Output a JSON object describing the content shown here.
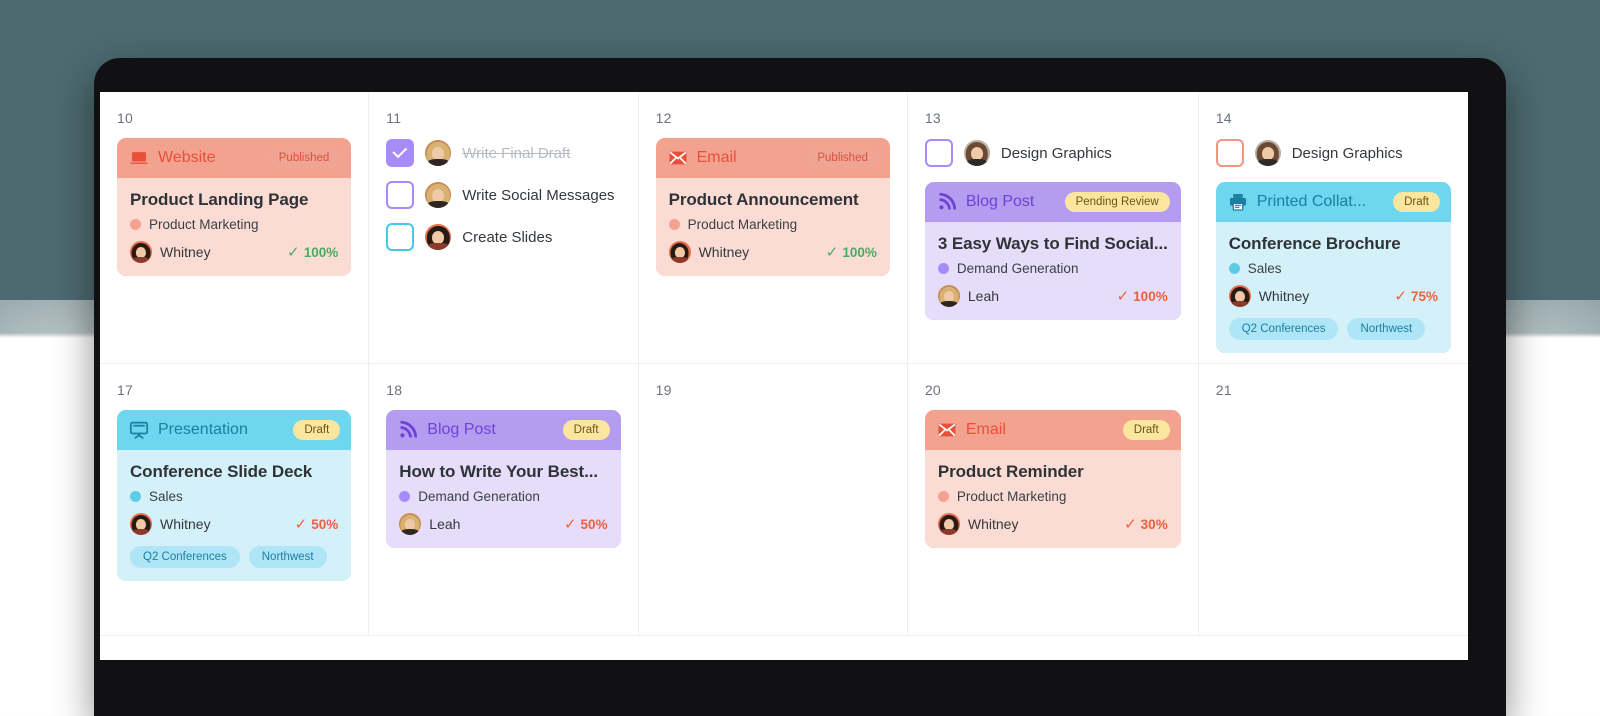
{
  "colors": {
    "backdrop_top": "#4d6a71",
    "salmon": "#f4a290",
    "salmon_body": "#fbdcd4",
    "salmon_text": "#e8503a",
    "purple": "#b49cf0",
    "purple_body": "#e6ddfb",
    "purple_text": "#6d43d6",
    "cyan": "#6fd6ef",
    "cyan_body": "#d4f1fa",
    "cyan_text": "#1b7fa0",
    "yellow_badge": "#fbe6a0",
    "yellow_badge_text": "#6b5518",
    "green": "#4aab63",
    "orange": "#ef5f3c",
    "grid_line": "#eceef0",
    "day_number": "#6b7280"
  },
  "calendar": {
    "days": [
      {
        "number": "10",
        "tasks": [],
        "card": {
          "type_label": "Website",
          "type_icon": "laptop-icon",
          "badge": "Published",
          "badge_style": "inline",
          "theme": "salmon",
          "title": "Product Landing Page",
          "campaign": "Product Marketing",
          "campaign_color": "#f4a290",
          "owner": "Whitney",
          "owner_avatar": "avatar-whitney",
          "progress": "100%",
          "progress_color": "green",
          "tags": []
        }
      },
      {
        "number": "11",
        "tasks": [
          {
            "label": "Write Final Draft",
            "checked": true,
            "done": true,
            "box_color": "purple",
            "avatar": "avatar-leah"
          },
          {
            "label": "Write Social Messages",
            "checked": false,
            "done": false,
            "box_color": "purple",
            "avatar": "avatar-leah"
          },
          {
            "label": "Create Slides",
            "checked": false,
            "done": false,
            "box_color": "cyan",
            "avatar": "avatar-whitney"
          }
        ],
        "card": null
      },
      {
        "number": "12",
        "tasks": [],
        "card": {
          "type_label": "Email",
          "type_icon": "envelope-icon",
          "badge": "Published",
          "badge_style": "inline",
          "theme": "salmon",
          "title": "Product Announcement",
          "campaign": "Product Marketing",
          "campaign_color": "#f4a290",
          "owner": "Whitney",
          "owner_avatar": "avatar-whitney",
          "progress": "100%",
          "progress_color": "green",
          "tags": []
        }
      },
      {
        "number": "13",
        "tasks": [
          {
            "label": "Design Graphics",
            "checked": false,
            "done": false,
            "box_color": "purple",
            "avatar": "avatar-designer"
          }
        ],
        "card": {
          "type_label": "Blog Post",
          "type_icon": "rss-icon",
          "badge": "Pending Review",
          "badge_style": "yellow",
          "theme": "purple",
          "title": "3 Easy Ways to Find Social...",
          "campaign": "Demand Generation",
          "campaign_color": "#a78bfa",
          "owner": "Leah",
          "owner_avatar": "avatar-leah",
          "progress": "100%",
          "progress_color": "orange",
          "tags": []
        }
      },
      {
        "number": "14",
        "tasks": [
          {
            "label": "Design Graphics",
            "checked": false,
            "done": false,
            "box_color": "salmon",
            "avatar": "avatar-designer"
          }
        ],
        "card": {
          "type_label": "Printed Collat...",
          "type_icon": "printer-icon",
          "badge": "Draft",
          "badge_style": "yellow",
          "theme": "cyan",
          "title": "Conference Brochure",
          "campaign": "Sales",
          "campaign_color": "#5fcbe8",
          "owner": "Whitney",
          "owner_avatar": "avatar-whitney",
          "progress": "75%",
          "progress_color": "orange",
          "tags": [
            "Q2 Conferences",
            "Northwest"
          ]
        }
      },
      {
        "number": "17",
        "tasks": [],
        "card": {
          "type_label": "Presentation",
          "type_icon": "presentation-icon",
          "badge": "Draft",
          "badge_style": "yellow",
          "theme": "cyan",
          "title": "Conference Slide Deck",
          "campaign": "Sales",
          "campaign_color": "#5fcbe8",
          "owner": "Whitney",
          "owner_avatar": "avatar-whitney",
          "progress": "50%",
          "progress_color": "orange",
          "tags": [
            "Q2 Conferences",
            "Northwest"
          ]
        }
      },
      {
        "number": "18",
        "tasks": [],
        "card": {
          "type_label": "Blog Post",
          "type_icon": "rss-icon",
          "badge": "Draft",
          "badge_style": "yellow",
          "theme": "purple",
          "title": "How to Write Your Best...",
          "campaign": "Demand Generation",
          "campaign_color": "#a78bfa",
          "owner": "Leah",
          "owner_avatar": "avatar-leah",
          "progress": "50%",
          "progress_color": "orange",
          "tags": []
        }
      },
      {
        "number": "19",
        "tasks": [],
        "card": null
      },
      {
        "number": "20",
        "tasks": [],
        "card": {
          "type_label": "Email",
          "type_icon": "envelope-icon",
          "badge": "Draft",
          "badge_style": "yellow",
          "theme": "salmon",
          "title": "Product Reminder",
          "campaign": "Product Marketing",
          "campaign_color": "#f4a290",
          "owner": "Whitney",
          "owner_avatar": "avatar-whitney",
          "progress": "30%",
          "progress_color": "orange",
          "tags": []
        }
      },
      {
        "number": "21",
        "tasks": [],
        "card": null
      }
    ]
  },
  "glyphs": {
    "check": "✓"
  }
}
